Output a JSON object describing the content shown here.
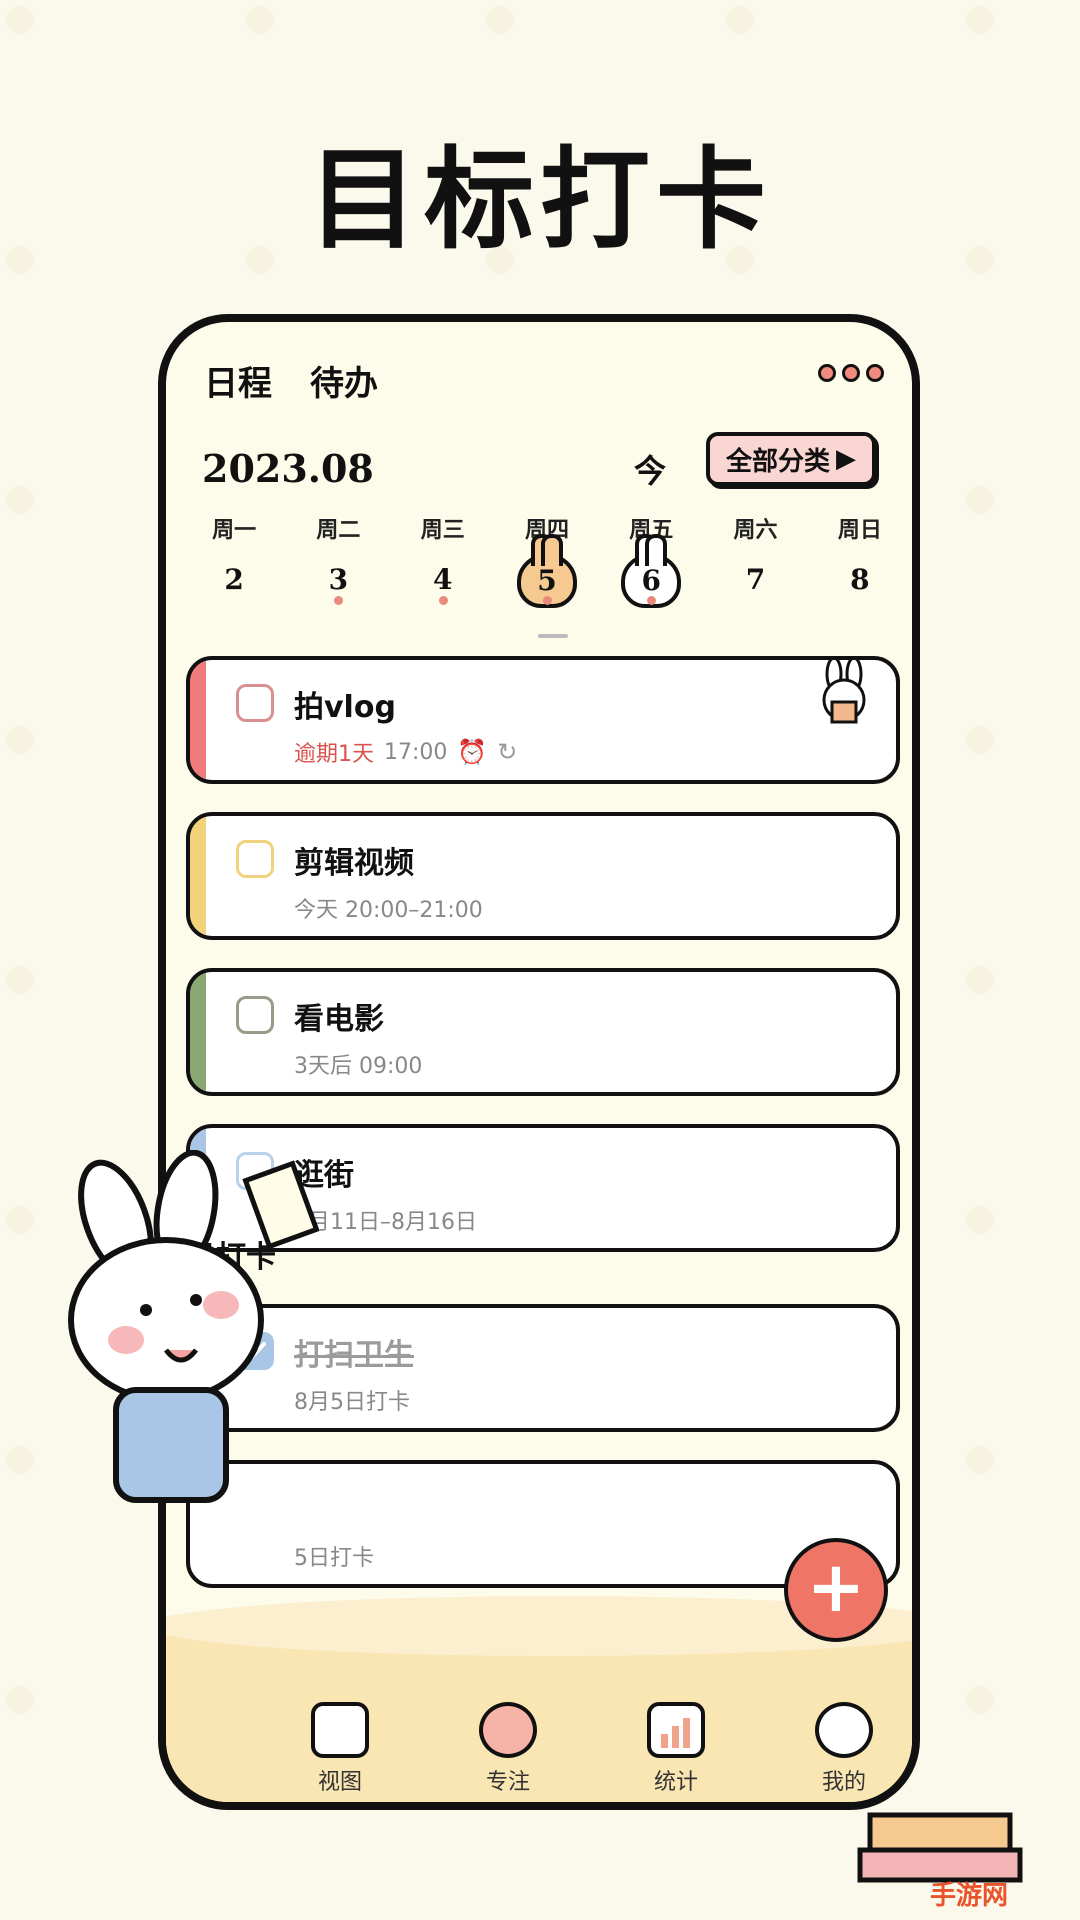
{
  "headline": "目标打卡",
  "tabs": {
    "schedule": "日程",
    "todo": "待办"
  },
  "date": {
    "year_month": "2023.08",
    "today": "今",
    "all_categories": "全部分类"
  },
  "week": [
    {
      "wd": "周一",
      "d": "2",
      "dot": false,
      "style": "plain"
    },
    {
      "wd": "周二",
      "d": "3",
      "dot": true,
      "style": "plain"
    },
    {
      "wd": "周三",
      "d": "4",
      "dot": true,
      "style": "plain"
    },
    {
      "wd": "周四",
      "d": "5",
      "dot": true,
      "style": "selected"
    },
    {
      "wd": "周五",
      "d": "6",
      "dot": true,
      "style": "current"
    },
    {
      "wd": "周六",
      "d": "7",
      "dot": false,
      "style": "plain"
    },
    {
      "wd": "周日",
      "d": "8",
      "dot": false,
      "style": "plain"
    }
  ],
  "tasks": [
    {
      "title": "拍vlog",
      "overdue": "逾期1天",
      "time": "17:00",
      "color": "#ef7b7b"
    },
    {
      "title": "剪辑视频",
      "time": "今天 20:00–21:00",
      "color": "#f3d37a"
    },
    {
      "title": "看电影",
      "time": "3天后 09:00",
      "color": "#8aa771"
    },
    {
      "title": "逛街",
      "time": "8月11日–8月16日",
      "color": "#a9c6e6"
    }
  ],
  "done_section": "已打卡",
  "done_tasks": [
    {
      "title": "打扫卫生",
      "time": "8月5日打卡",
      "color": "#a9c6e6"
    },
    {
      "title": "",
      "time": "5日打卡",
      "color": "#ffffff"
    }
  ],
  "fab": "+",
  "nav": [
    {
      "label": "视图",
      "icon": "calendar-icon"
    },
    {
      "label": "专注",
      "icon": "alarm-clock-icon"
    },
    {
      "label": "统计",
      "icon": "bar-chart-icon"
    },
    {
      "label": "我的",
      "icon": "bunny-avatar-icon"
    }
  ],
  "watermark": "手游网"
}
